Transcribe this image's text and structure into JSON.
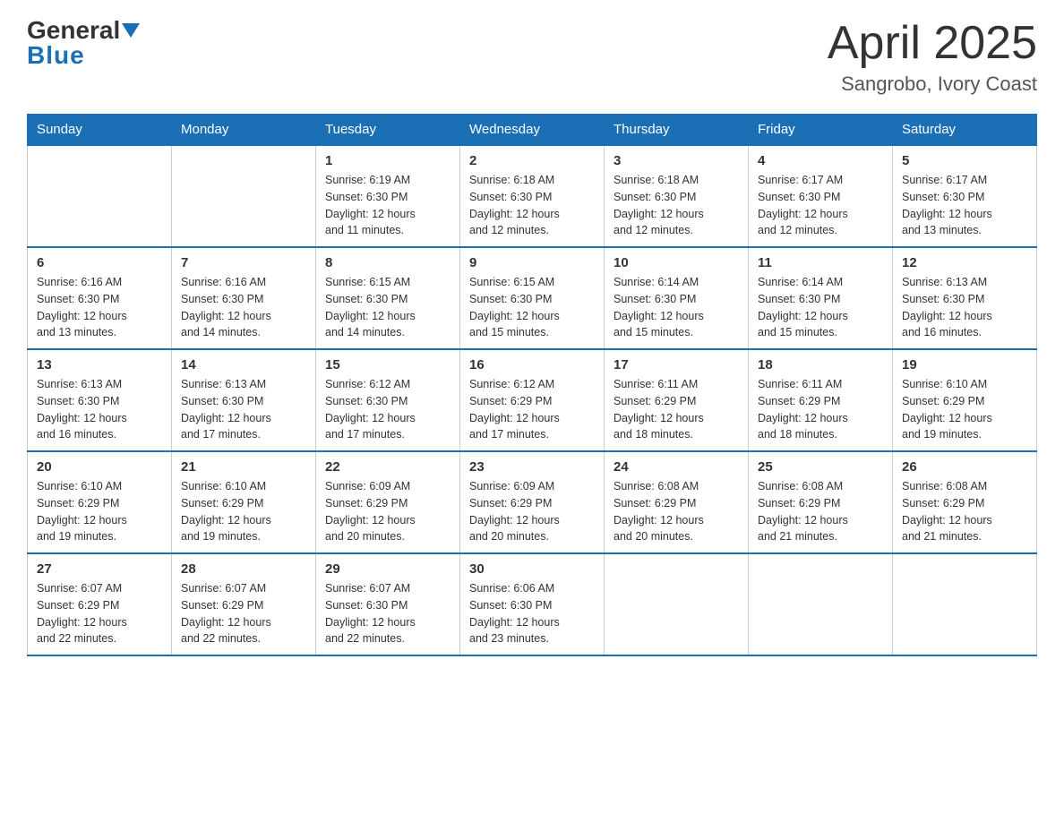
{
  "header": {
    "logo": {
      "general": "General",
      "blue": "Blue"
    },
    "title": "April 2025",
    "location": "Sangrobo, Ivory Coast"
  },
  "days_of_week": [
    "Sunday",
    "Monday",
    "Tuesday",
    "Wednesday",
    "Thursday",
    "Friday",
    "Saturday"
  ],
  "weeks": [
    [
      {
        "day": "",
        "info": ""
      },
      {
        "day": "",
        "info": ""
      },
      {
        "day": "1",
        "info": "Sunrise: 6:19 AM\nSunset: 6:30 PM\nDaylight: 12 hours\nand 11 minutes."
      },
      {
        "day": "2",
        "info": "Sunrise: 6:18 AM\nSunset: 6:30 PM\nDaylight: 12 hours\nand 12 minutes."
      },
      {
        "day": "3",
        "info": "Sunrise: 6:18 AM\nSunset: 6:30 PM\nDaylight: 12 hours\nand 12 minutes."
      },
      {
        "day": "4",
        "info": "Sunrise: 6:17 AM\nSunset: 6:30 PM\nDaylight: 12 hours\nand 12 minutes."
      },
      {
        "day": "5",
        "info": "Sunrise: 6:17 AM\nSunset: 6:30 PM\nDaylight: 12 hours\nand 13 minutes."
      }
    ],
    [
      {
        "day": "6",
        "info": "Sunrise: 6:16 AM\nSunset: 6:30 PM\nDaylight: 12 hours\nand 13 minutes."
      },
      {
        "day": "7",
        "info": "Sunrise: 6:16 AM\nSunset: 6:30 PM\nDaylight: 12 hours\nand 14 minutes."
      },
      {
        "day": "8",
        "info": "Sunrise: 6:15 AM\nSunset: 6:30 PM\nDaylight: 12 hours\nand 14 minutes."
      },
      {
        "day": "9",
        "info": "Sunrise: 6:15 AM\nSunset: 6:30 PM\nDaylight: 12 hours\nand 15 minutes."
      },
      {
        "day": "10",
        "info": "Sunrise: 6:14 AM\nSunset: 6:30 PM\nDaylight: 12 hours\nand 15 minutes."
      },
      {
        "day": "11",
        "info": "Sunrise: 6:14 AM\nSunset: 6:30 PM\nDaylight: 12 hours\nand 15 minutes."
      },
      {
        "day": "12",
        "info": "Sunrise: 6:13 AM\nSunset: 6:30 PM\nDaylight: 12 hours\nand 16 minutes."
      }
    ],
    [
      {
        "day": "13",
        "info": "Sunrise: 6:13 AM\nSunset: 6:30 PM\nDaylight: 12 hours\nand 16 minutes."
      },
      {
        "day": "14",
        "info": "Sunrise: 6:13 AM\nSunset: 6:30 PM\nDaylight: 12 hours\nand 17 minutes."
      },
      {
        "day": "15",
        "info": "Sunrise: 6:12 AM\nSunset: 6:30 PM\nDaylight: 12 hours\nand 17 minutes."
      },
      {
        "day": "16",
        "info": "Sunrise: 6:12 AM\nSunset: 6:29 PM\nDaylight: 12 hours\nand 17 minutes."
      },
      {
        "day": "17",
        "info": "Sunrise: 6:11 AM\nSunset: 6:29 PM\nDaylight: 12 hours\nand 18 minutes."
      },
      {
        "day": "18",
        "info": "Sunrise: 6:11 AM\nSunset: 6:29 PM\nDaylight: 12 hours\nand 18 minutes."
      },
      {
        "day": "19",
        "info": "Sunrise: 6:10 AM\nSunset: 6:29 PM\nDaylight: 12 hours\nand 19 minutes."
      }
    ],
    [
      {
        "day": "20",
        "info": "Sunrise: 6:10 AM\nSunset: 6:29 PM\nDaylight: 12 hours\nand 19 minutes."
      },
      {
        "day": "21",
        "info": "Sunrise: 6:10 AM\nSunset: 6:29 PM\nDaylight: 12 hours\nand 19 minutes."
      },
      {
        "day": "22",
        "info": "Sunrise: 6:09 AM\nSunset: 6:29 PM\nDaylight: 12 hours\nand 20 minutes."
      },
      {
        "day": "23",
        "info": "Sunrise: 6:09 AM\nSunset: 6:29 PM\nDaylight: 12 hours\nand 20 minutes."
      },
      {
        "day": "24",
        "info": "Sunrise: 6:08 AM\nSunset: 6:29 PM\nDaylight: 12 hours\nand 20 minutes."
      },
      {
        "day": "25",
        "info": "Sunrise: 6:08 AM\nSunset: 6:29 PM\nDaylight: 12 hours\nand 21 minutes."
      },
      {
        "day": "26",
        "info": "Sunrise: 6:08 AM\nSunset: 6:29 PM\nDaylight: 12 hours\nand 21 minutes."
      }
    ],
    [
      {
        "day": "27",
        "info": "Sunrise: 6:07 AM\nSunset: 6:29 PM\nDaylight: 12 hours\nand 22 minutes."
      },
      {
        "day": "28",
        "info": "Sunrise: 6:07 AM\nSunset: 6:29 PM\nDaylight: 12 hours\nand 22 minutes."
      },
      {
        "day": "29",
        "info": "Sunrise: 6:07 AM\nSunset: 6:30 PM\nDaylight: 12 hours\nand 22 minutes."
      },
      {
        "day": "30",
        "info": "Sunrise: 6:06 AM\nSunset: 6:30 PM\nDaylight: 12 hours\nand 23 minutes."
      },
      {
        "day": "",
        "info": ""
      },
      {
        "day": "",
        "info": ""
      },
      {
        "day": "",
        "info": ""
      }
    ]
  ]
}
